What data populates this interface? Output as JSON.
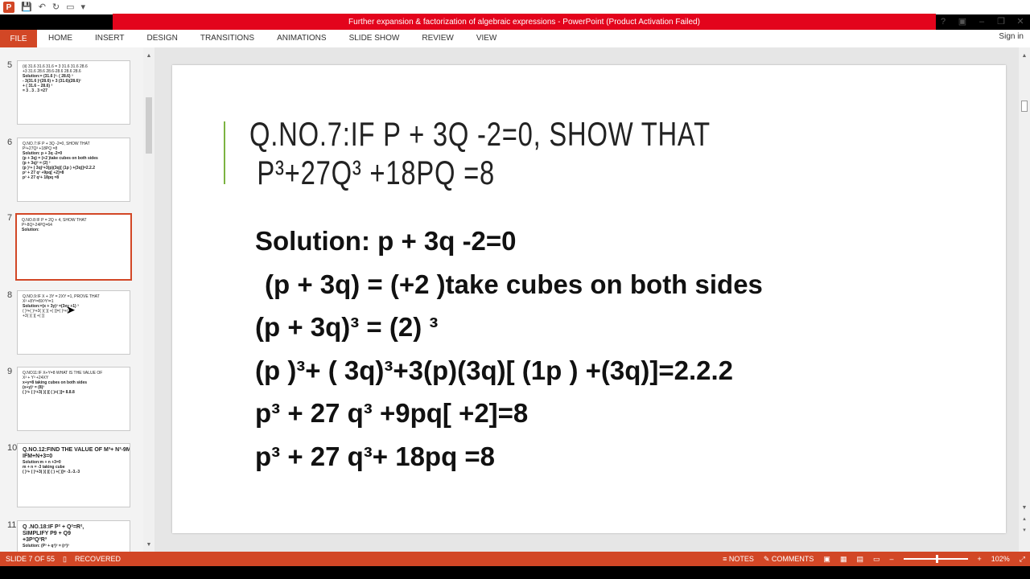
{
  "window": {
    "title": "Further expansion & factorization of algebraic expressions -  PowerPoint (Product Activation Failed)",
    "controls": [
      "?",
      "▣",
      "–",
      "❐",
      "✕"
    ]
  },
  "qat": {
    "logo": "P"
  },
  "ribbon": {
    "file": "FILE",
    "tabs": [
      "HOME",
      "INSERT",
      "DESIGN",
      "TRANSITIONS",
      "ANIMATIONS",
      "SLIDE SHOW",
      "REVIEW",
      "VIEW"
    ],
    "signin": "Sign in"
  },
  "thumbnails": [
    {
      "num": "5",
      "lines": [
        "(ii) 31.6 31.6 31.6 = 3 31.6 31.6 28.6",
        "+3 31.6 28.6 28.6-28.6 28.6 28.6",
        "Solution:= (31.6 )³- ( 28.6) ³",
        "- 3(31.6 )²(28.6) + 3 (31.6)(28.6)²",
        "+ ( 31.6 – 28.6) ³",
        "= 3 . 3 . 3 =27"
      ]
    },
    {
      "num": "6",
      "lines": [
        "Q.NO.7:IF P + 3Q -2=0, SHOW THAT",
        "P³+27Q³ +18PQ =8",
        "Solution: p + 3q -2=0",
        "(p + 3q) = (+2 )take cubes on both sides",
        "(p + 3q)³ = (2) ³",
        "(p )³+ ( 3q)³+3(p)(3q)[ (1p ) +(3q)]=2.2.2",
        "p³ + 27 q³ +9pq[ +2]=8",
        "p³ + 27 q³+ 18pq =8"
      ]
    },
    {
      "num": "7",
      "lines": [
        "Q.NO.8:IF P = 2Q + 4, SHOW THAT",
        "P³-8Q³-24PQ=64",
        "Solution:"
      ]
    },
    {
      "num": "8",
      "lines": [
        "Q.NO.9:IF X + 3Y = 2XY =1, PROVE THAT",
        "X³ +8Y³=8X³Y³=1",
        "Solution:=(x + 3y)³ =(3xy +1) ³",
        "( )³+( )³+3( )( )[ +( )]=( )³+( )³",
        "+3( )( )[ +( )]"
      ]
    },
    {
      "num": "9",
      "lines": [
        "Q.NO11:IF X+Y=8 WHAT IS THE VALUE OF",
        "X³ + Y³ +24XY",
        "x+y=8 taking cubes on both sides",
        "(x+y)³ = (8)³",
        "( )³+ ( )³+3( )( )[ ( )+( )]= 8.8.8"
      ]
    },
    {
      "num": "10",
      "lines": [
        "Q.NO.12:FIND THE VALUE OF M³+ N³-9MN,",
        "IFM+N+3=0",
        "Solution:m + n +3=0",
        "m + n  = -3 taking cube",
        "( )³+ ( )³+3( )( )[ ( ) +( )]= -3.-3.-3"
      ]
    },
    {
      "num": "11",
      "lines": [
        "Q .NO.18:IF P² + Q²=R²,",
        "SIMPLIFY P9 + Q9",
        "+3P³Q³R³",
        "Solution: (P³ + q³)³ = (r³)³"
      ]
    }
  ],
  "slide": {
    "title_line1": "Q.NO.7:IF P + 3Q -2=0, SHOW THAT",
    "title_line2": "P³+27Q³ +18PQ =8",
    "body": [
      "Solution: p + 3q -2=0",
      " (p + 3q) = (+2 )take cubes on both sides",
      "(p + 3q)³ = (2) ³",
      "(p )³+ ( 3q)³+3(p)(3q)[ (1p ) +(3q)]=2.2.2",
      "p³ + 27 q³ +9pq[ +2]=8",
      "p³ + 27 q³+ 18pq =8"
    ]
  },
  "status": {
    "slide": "SLIDE 7 OF 55",
    "recovered": "RECOVERED",
    "notes": "NOTES",
    "comments": "COMMENTS",
    "zoom": "102%"
  },
  "colors": {
    "accent": "#d24726",
    "title_red": "#e3041c",
    "slide_bar": "#7cb342"
  }
}
